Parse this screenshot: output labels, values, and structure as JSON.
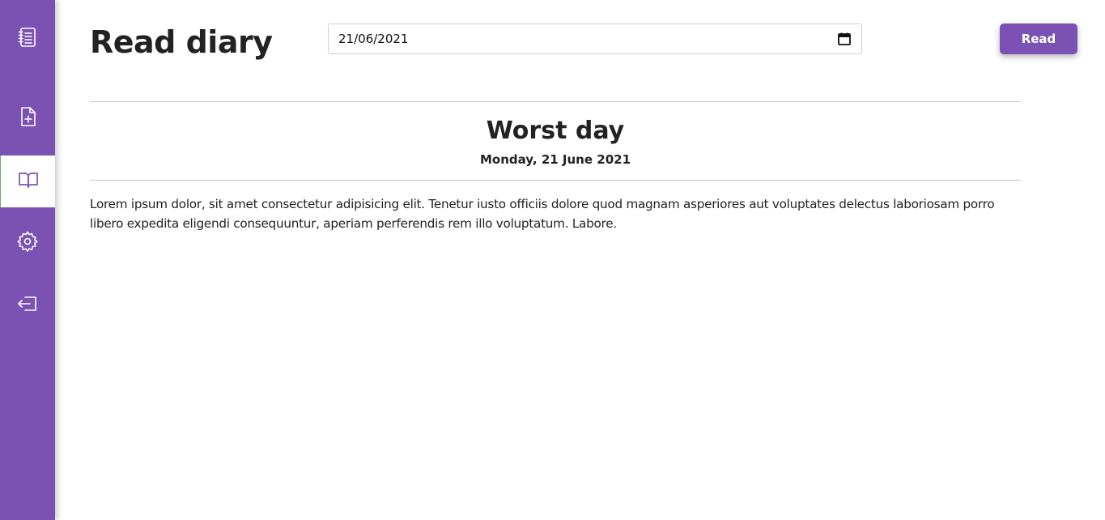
{
  "sidebar": {
    "items": [
      {
        "icon": "notebook-list-icon"
      },
      {
        "icon": "new-file-icon"
      },
      {
        "icon": "open-book-icon",
        "active": true
      },
      {
        "icon": "gear-icon"
      },
      {
        "icon": "logout-icon"
      }
    ],
    "color": "#7b52b4"
  },
  "header": {
    "title": "Read diary",
    "date_value": "21/06/2021",
    "read_label": "Read"
  },
  "entry": {
    "title": "Worst day",
    "date": "Monday, 21 June 2021",
    "body": "Lorem ipsum dolor, sit amet consectetur adipisicing elit. Tenetur iusto officiis dolore quod magnam asperiores aut voluptates delectus laboriosam porro libero expedita eligendi consequuntur, aperiam perferendis rem illo voluptatum. Labore."
  }
}
